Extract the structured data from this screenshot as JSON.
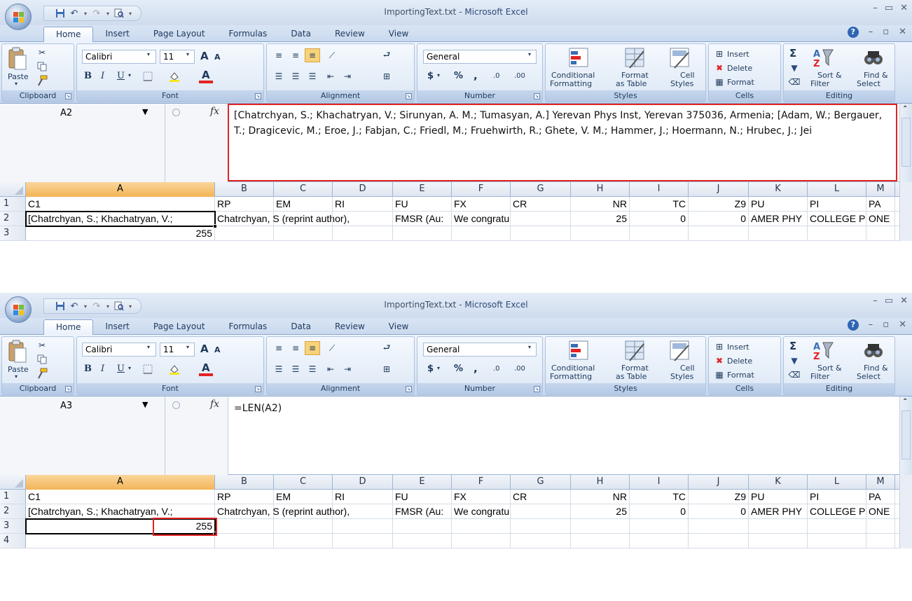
{
  "title": {
    "file": "ImportingText.txt",
    "separator": " - ",
    "app": "Microsoft Excel"
  },
  "tabs": [
    "Home",
    "Insert",
    "Page Layout",
    "Formulas",
    "Data",
    "Review",
    "View"
  ],
  "ribbon": {
    "clipboard": {
      "label": "Clipboard",
      "paste": "Paste"
    },
    "font": {
      "label": "Font",
      "name": "Calibri",
      "size": "11",
      "bold": "B",
      "italic": "I",
      "underline": "U",
      "grow": "A",
      "shrink": "A",
      "font_color": "A"
    },
    "alignment": {
      "label": "Alignment"
    },
    "number": {
      "label": "Number",
      "format": "General",
      "currency": "$",
      "percent": "%",
      "comma": ",",
      "inc": ".0",
      "dec": ".00"
    },
    "styles": {
      "label": "Styles",
      "cond1": "Conditional",
      "cond2": "Formatting",
      "fmt1": "Format",
      "fmt2": "as Table",
      "cell1": "Cell",
      "cell2": "Styles"
    },
    "cells": {
      "label": "Cells",
      "insert": "Insert",
      "delete": "Delete",
      "format": "Format"
    },
    "editing": {
      "label": "Editing",
      "sigma": "Σ",
      "sort1": "Sort &",
      "sort2": "Filter",
      "find1": "Find &",
      "find2": "Select"
    }
  },
  "columns": [
    {
      "letter": "A",
      "width": 270
    },
    {
      "letter": "B",
      "width": 84
    },
    {
      "letter": "C",
      "width": 84
    },
    {
      "letter": "D",
      "width": 86
    },
    {
      "letter": "E",
      "width": 84
    },
    {
      "letter": "F",
      "width": 84
    },
    {
      "letter": "G",
      "width": 86
    },
    {
      "letter": "H",
      "width": 84
    },
    {
      "letter": "I",
      "width": 84
    },
    {
      "letter": "J",
      "width": 86
    },
    {
      "letter": "K",
      "width": 84
    },
    {
      "letter": "L",
      "width": 84
    },
    {
      "letter": "M",
      "width": 41
    }
  ],
  "windows": [
    {
      "namebox": "A2",
      "formula": "[Chatrchyan, S.; Khachatryan, V.; Sirunyan, A. M.; Tumasyan, A.] Yerevan Phys Inst, Yerevan 375036, Armenia; [Adam, W.; Bergauer, T.; Dragicevic, M.; Eroe, J.; Fabjan, C.; Friedl, M.; Fruehwirth, R.; Ghete, V. M.; Hammer, J.; Hoermann, N.; Hrubec, J.; Jei",
      "rows": [
        {
          "num": "1",
          "cells": [
            "C1",
            "RP",
            "EM",
            "RI",
            "FU",
            "FX",
            "CR",
            "NR",
            "TC",
            "Z9",
            "PU",
            "PI",
            "PA"
          ]
        },
        {
          "num": "2",
          "cells": [
            "[Chatrchyan, S.; Khachatryan, V.;",
            "Chatrchyan, S (reprint author),",
            "",
            "",
            "FMSR (Au:",
            "We congratulate our",
            "",
            "25",
            "0",
            "0",
            "AMER PHY",
            "COLLEGE P",
            "ONE"
          ]
        },
        {
          "num": "3",
          "cells": [
            "255",
            "",
            "",
            "",
            "",
            "",
            "",
            "",
            "",
            "",
            "",
            "",
            ""
          ]
        }
      ]
    },
    {
      "namebox": "A3",
      "formula": "=LEN(A2)",
      "rows": [
        {
          "num": "1",
          "cells": [
            "C1",
            "RP",
            "EM",
            "RI",
            "FU",
            "FX",
            "CR",
            "NR",
            "TC",
            "Z9",
            "PU",
            "PI",
            "PA"
          ]
        },
        {
          "num": "2",
          "cells": [
            "[Chatrchyan, S.; Khachatryan, V.;",
            "Chatrchyan, S (reprint author),",
            "",
            "",
            "FMSR (Au:",
            "We congratulate our",
            "",
            "25",
            "0",
            "0",
            "AMER PHY",
            "COLLEGE P",
            "ONE"
          ]
        },
        {
          "num": "3",
          "cells": [
            "255",
            "",
            "",
            "",
            "",
            "",
            "",
            "",
            "",
            "",
            "",
            "",
            ""
          ]
        },
        {
          "num": "4",
          "cells": [
            "",
            "",
            "",
            "",
            "",
            "",
            "",
            "",
            "",
            "",
            "",
            "",
            ""
          ]
        }
      ]
    }
  ]
}
